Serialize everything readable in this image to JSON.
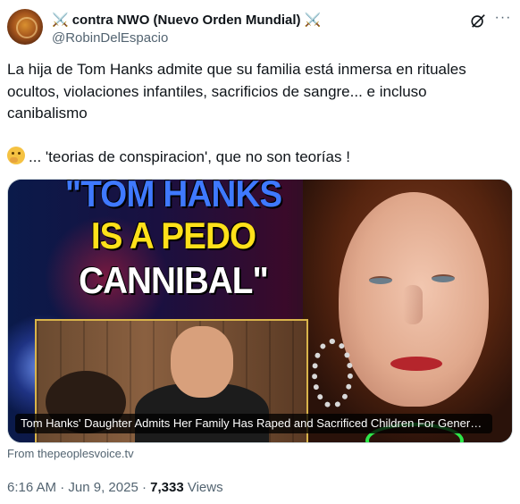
{
  "author": {
    "display_name": "contra NWO (Nuevo Orden Mundial)",
    "name_emoji_left": "⚔️",
    "name_emoji_right": "⚔️",
    "handle": "@RobinDelEspacio",
    "avatar_icon": "golden-avatar"
  },
  "actions": {
    "grok_icon": "grok-icon",
    "more_label": "···"
  },
  "tweet": {
    "line1": "La hija de Tom Hanks admite que su familia está inmersa en rituales ocultos, violaciones infantiles, sacrificios de sangre... e incluso canibalismo",
    "line2_emoji": "thinking-face-emoji",
    "line2": "... 'teorias de conspiracion', que no son teorías !"
  },
  "card": {
    "headline_1": "\"TOM HANKS",
    "headline_2": "IS A PEDO",
    "headline_3": "CANNIBAL\"",
    "caption": "Tom Hanks' Daughter Admits Her Family Has Raped and Sacrificed Children For Generations",
    "colors": {
      "headline_blue": "#3f79ff",
      "headline_yellow": "#ffe11a",
      "headline_white": "#ffffff",
      "frame_gold": "#d9b44a"
    }
  },
  "source": "From thepeoplesvoice.tv",
  "meta": {
    "time": "6:16 AM",
    "sep1": " · ",
    "date": "Jun 9, 2025",
    "sep2": " · ",
    "views_count": "7,333",
    "views_label": " Views"
  }
}
